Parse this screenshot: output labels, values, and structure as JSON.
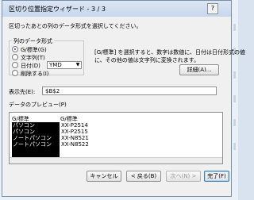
{
  "dialog": {
    "title": "区切り位置指定ウィザード - 3 / 3",
    "help": "?",
    "instruction": "区切ったあとの列のデータ形式を選択してください。"
  },
  "column_format": {
    "legend": "列のデータ形式",
    "options": [
      {
        "label": "G/標準(G)",
        "selected": true
      },
      {
        "label": "文字列(T)",
        "selected": false
      },
      {
        "label": "日付(D)",
        "selected": false
      },
      {
        "label": "削除する(I)",
        "selected": false
      }
    ],
    "date_format": "YMD",
    "description_line1": "[G/標準] を選択すると、数字は数値に、日付は日付形式の値",
    "description_line2": "に、その他の値は文字列に変換されます。",
    "detail_button": "詳細(A)..."
  },
  "destination": {
    "label": "表示先(E):",
    "value": "$B$2"
  },
  "preview": {
    "label": "データのプレビュー(P)",
    "col1_header": "G/標準",
    "col2_header": "G/標準",
    "col1": [
      "パソコン",
      "パソコン",
      "ノートパソコン",
      "ノートパソコン"
    ],
    "col2": [
      "XX-P2514",
      "XX-P2515",
      "XX-N8521",
      "XX-N8522"
    ]
  },
  "buttons": {
    "cancel": "キャンセル",
    "back": "< 戻る(B)",
    "next": "次へ(N) >",
    "finish": "完了(F)"
  },
  "colors": {
    "preview_selected_bg": "#000000",
    "preview_selected_fg": "#ffffff"
  }
}
